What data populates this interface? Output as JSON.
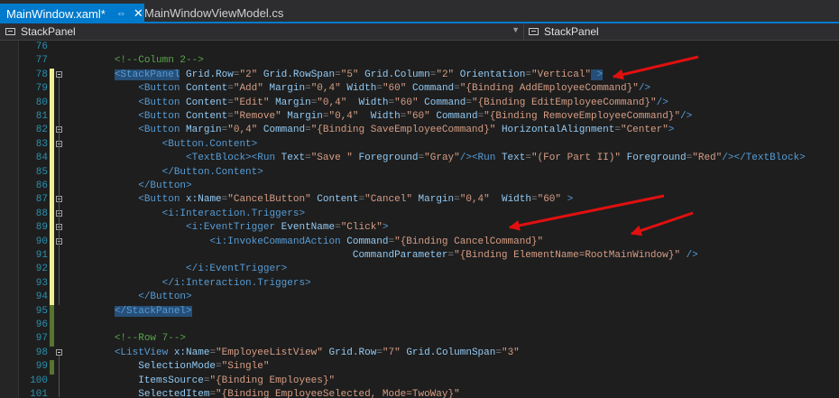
{
  "tabs": [
    {
      "label": "MainWindow.xaml*",
      "active": true
    },
    {
      "label": "MainWindowViewModel.cs",
      "active": false
    }
  ],
  "nav": {
    "left_combo": "StackPanel",
    "right_combo": "StackPanel"
  },
  "editor": {
    "lines": [
      {
        "n": "76",
        "chg": "",
        "fold": false,
        "t": [
          [
            "",
            ""
          ]
        ]
      },
      {
        "n": "77",
        "chg": "",
        "fold": false,
        "t": [
          [
            "        ",
            ""
          ],
          [
            "<!--Column 2-->",
            "c-cmt"
          ]
        ]
      },
      {
        "n": "78",
        "chg": "y",
        "fold": true,
        "t": [
          [
            "        ",
            ""
          ],
          [
            "<StackPanel",
            "c-tag sel"
          ],
          [
            " Grid.Row",
            "c-attr"
          ],
          [
            "=",
            "c-gray"
          ],
          [
            "\"2\"",
            "c-str"
          ],
          [
            " Grid.RowSpan",
            "c-attr"
          ],
          [
            "=",
            "c-gray"
          ],
          [
            "\"5\"",
            "c-str"
          ],
          [
            " Grid.Column",
            "c-attr"
          ],
          [
            "=",
            "c-gray"
          ],
          [
            "\"2\"",
            "c-str"
          ],
          [
            " Orientation",
            "c-attr"
          ],
          [
            "=",
            "c-gray"
          ],
          [
            "\"Vertical\"",
            "c-str"
          ],
          [
            " >",
            "c-tag sel"
          ]
        ]
      },
      {
        "n": "79",
        "chg": "y",
        "fold": false,
        "t": [
          [
            "            ",
            ""
          ],
          [
            "<Button",
            "c-tag"
          ],
          [
            " Content",
            "c-attr"
          ],
          [
            "=",
            "c-gray"
          ],
          [
            "\"Add\"",
            "c-str"
          ],
          [
            " Margin",
            "c-attr"
          ],
          [
            "=",
            "c-gray"
          ],
          [
            "\"0,4\"",
            "c-str"
          ],
          [
            " Width",
            "c-attr"
          ],
          [
            "=",
            "c-gray"
          ],
          [
            "\"60\"",
            "c-str"
          ],
          [
            " Command",
            "c-attr"
          ],
          [
            "=",
            "c-gray"
          ],
          [
            "\"{Binding AddEmployeeCommand}\"",
            "c-str"
          ],
          [
            "/>",
            "c-tag"
          ]
        ]
      },
      {
        "n": "80",
        "chg": "y",
        "fold": false,
        "t": [
          [
            "            ",
            ""
          ],
          [
            "<Button",
            "c-tag"
          ],
          [
            " Content",
            "c-attr"
          ],
          [
            "=",
            "c-gray"
          ],
          [
            "\"Edit\"",
            "c-str"
          ],
          [
            " Margin",
            "c-attr"
          ],
          [
            "=",
            "c-gray"
          ],
          [
            "\"0,4\"",
            "c-str"
          ],
          [
            "  Width",
            "c-attr"
          ],
          [
            "=",
            "c-gray"
          ],
          [
            "\"60\"",
            "c-str"
          ],
          [
            " Command",
            "c-attr"
          ],
          [
            "=",
            "c-gray"
          ],
          [
            "\"{Binding EditEmployeeCommand}\"",
            "c-str"
          ],
          [
            "/>",
            "c-tag"
          ]
        ]
      },
      {
        "n": "81",
        "chg": "y",
        "fold": false,
        "t": [
          [
            "            ",
            ""
          ],
          [
            "<Button",
            "c-tag"
          ],
          [
            " Content",
            "c-attr"
          ],
          [
            "=",
            "c-gray"
          ],
          [
            "\"Remove\"",
            "c-str"
          ],
          [
            " Margin",
            "c-attr"
          ],
          [
            "=",
            "c-gray"
          ],
          [
            "\"0,4\"",
            "c-str"
          ],
          [
            "  Width",
            "c-attr"
          ],
          [
            "=",
            "c-gray"
          ],
          [
            "\"60\"",
            "c-str"
          ],
          [
            " Command",
            "c-attr"
          ],
          [
            "=",
            "c-gray"
          ],
          [
            "\"{Binding RemoveEmployeeCommand}\"",
            "c-str"
          ],
          [
            "/>",
            "c-tag"
          ]
        ]
      },
      {
        "n": "82",
        "chg": "y",
        "fold": true,
        "t": [
          [
            "            ",
            ""
          ],
          [
            "<Button",
            "c-tag"
          ],
          [
            " Margin",
            "c-attr"
          ],
          [
            "=",
            "c-gray"
          ],
          [
            "\"0,4\"",
            "c-str"
          ],
          [
            " Command",
            "c-attr"
          ],
          [
            "=",
            "c-gray"
          ],
          [
            "\"{Binding SaveEmployeeCommand}\"",
            "c-str"
          ],
          [
            " HorizontalAlignment",
            "c-attr"
          ],
          [
            "=",
            "c-gray"
          ],
          [
            "\"Center\"",
            "c-str"
          ],
          [
            ">",
            "c-tag"
          ]
        ]
      },
      {
        "n": "83",
        "chg": "y",
        "fold": true,
        "t": [
          [
            "                ",
            ""
          ],
          [
            "<Button.Content>",
            "c-tag"
          ]
        ]
      },
      {
        "n": "84",
        "chg": "y",
        "fold": false,
        "t": [
          [
            "                    ",
            ""
          ],
          [
            "<TextBlock>",
            "c-tag"
          ],
          [
            "<Run",
            "c-tag"
          ],
          [
            " Text",
            "c-attr"
          ],
          [
            "=",
            "c-gray"
          ],
          [
            "\"Save \"",
            "c-str"
          ],
          [
            " Foreground",
            "c-attr"
          ],
          [
            "=",
            "c-gray"
          ],
          [
            "\"Gray\"",
            "c-str"
          ],
          [
            "/>",
            "c-tag"
          ],
          [
            "<Run",
            "c-tag"
          ],
          [
            " Text",
            "c-attr"
          ],
          [
            "=",
            "c-gray"
          ],
          [
            "\"(For Part II)\"",
            "c-str"
          ],
          [
            " Foreground",
            "c-attr"
          ],
          [
            "=",
            "c-gray"
          ],
          [
            "\"Red\"",
            "c-str"
          ],
          [
            "/>",
            "c-tag"
          ],
          [
            "</TextBlock>",
            "c-tag"
          ]
        ]
      },
      {
        "n": "85",
        "chg": "y",
        "fold": false,
        "t": [
          [
            "                ",
            ""
          ],
          [
            "</Button.Content>",
            "c-tag"
          ]
        ]
      },
      {
        "n": "86",
        "chg": "y",
        "fold": false,
        "t": [
          [
            "            ",
            ""
          ],
          [
            "</Button>",
            "c-tag"
          ]
        ]
      },
      {
        "n": "87",
        "chg": "y",
        "fold": true,
        "t": [
          [
            "            ",
            ""
          ],
          [
            "<Button",
            "c-tag"
          ],
          [
            " x:Name",
            "c-attr"
          ],
          [
            "=",
            "c-gray"
          ],
          [
            "\"CancelButton\"",
            "c-str"
          ],
          [
            " Content",
            "c-attr"
          ],
          [
            "=",
            "c-gray"
          ],
          [
            "\"Cancel\"",
            "c-str"
          ],
          [
            " Margin",
            "c-attr"
          ],
          [
            "=",
            "c-gray"
          ],
          [
            "\"0,4\"",
            "c-str"
          ],
          [
            "  Width",
            "c-attr"
          ],
          [
            "=",
            "c-gray"
          ],
          [
            "\"60\"",
            "c-str"
          ],
          [
            " >",
            "c-tag"
          ]
        ]
      },
      {
        "n": "88",
        "chg": "y",
        "fold": true,
        "t": [
          [
            "                ",
            ""
          ],
          [
            "<i:Interaction.Triggers>",
            "c-tag"
          ]
        ]
      },
      {
        "n": "89",
        "chg": "y",
        "fold": true,
        "t": [
          [
            "                    ",
            ""
          ],
          [
            "<i:EventTrigger",
            "c-tag"
          ],
          [
            " EventName",
            "c-attr"
          ],
          [
            "=",
            "c-gray"
          ],
          [
            "\"Click\"",
            "c-str"
          ],
          [
            ">",
            "c-tag"
          ]
        ]
      },
      {
        "n": "90",
        "chg": "y",
        "fold": true,
        "t": [
          [
            "                        ",
            ""
          ],
          [
            "<i:InvokeCommandAction",
            "c-tag"
          ],
          [
            " Command",
            "c-attr"
          ],
          [
            "=",
            "c-gray"
          ],
          [
            "\"{Binding CancelCommand}\"",
            "c-str"
          ]
        ]
      },
      {
        "n": "91",
        "chg": "y",
        "fold": false,
        "t": [
          [
            "                                                ",
            ""
          ],
          [
            "CommandParameter",
            "c-attr"
          ],
          [
            "=",
            "c-gray"
          ],
          [
            "\"{Binding ElementName=RootMainWindow}\"",
            "c-str"
          ],
          [
            " />",
            "c-tag"
          ]
        ]
      },
      {
        "n": "92",
        "chg": "y",
        "fold": false,
        "t": [
          [
            "                    ",
            ""
          ],
          [
            "</i:EventTrigger>",
            "c-tag"
          ]
        ]
      },
      {
        "n": "93",
        "chg": "y",
        "fold": false,
        "t": [
          [
            "                ",
            ""
          ],
          [
            "</i:Interaction.Triggers>",
            "c-tag"
          ]
        ]
      },
      {
        "n": "94",
        "chg": "y",
        "fold": false,
        "t": [
          [
            "            ",
            ""
          ],
          [
            "</Button>",
            "c-tag"
          ]
        ]
      },
      {
        "n": "95",
        "chg": "g",
        "fold": false,
        "t": [
          [
            "        ",
            ""
          ],
          [
            "</StackPanel>",
            "c-tag sel"
          ]
        ]
      },
      {
        "n": "96",
        "chg": "g",
        "fold": false,
        "t": [
          [
            "",
            ""
          ]
        ]
      },
      {
        "n": "97",
        "chg": "g",
        "fold": false,
        "t": [
          [
            "        ",
            ""
          ],
          [
            "<!--Row 7-->",
            "c-cmt"
          ]
        ]
      },
      {
        "n": "98",
        "chg": "",
        "fold": true,
        "t": [
          [
            "        ",
            ""
          ],
          [
            "<ListView",
            "c-tag"
          ],
          [
            " x:Name",
            "c-attr"
          ],
          [
            "=",
            "c-gray"
          ],
          [
            "\"EmployeeListView\"",
            "c-str"
          ],
          [
            " Grid.Row",
            "c-attr"
          ],
          [
            "=",
            "c-gray"
          ],
          [
            "\"7\"",
            "c-str"
          ],
          [
            " Grid.ColumnSpan",
            "c-attr"
          ],
          [
            "=",
            "c-gray"
          ],
          [
            "\"3\"",
            "c-str"
          ]
        ]
      },
      {
        "n": "99",
        "chg": "g",
        "fold": false,
        "t": [
          [
            "            ",
            ""
          ],
          [
            "SelectionMode",
            "c-attr"
          ],
          [
            "=",
            "c-gray"
          ],
          [
            "\"Single\"",
            "c-str"
          ]
        ]
      },
      {
        "n": "100",
        "chg": "",
        "fold": false,
        "t": [
          [
            "            ",
            ""
          ],
          [
            "ItemsSource",
            "c-attr"
          ],
          [
            "=",
            "c-gray"
          ],
          [
            "\"{Binding Employees}\"",
            "c-str"
          ]
        ]
      },
      {
        "n": "101",
        "chg": "",
        "fold": false,
        "t": [
          [
            "            ",
            ""
          ],
          [
            "SelectedItem",
            "c-attr"
          ],
          [
            "=",
            "c-gray"
          ],
          [
            "\"{Binding EmployeeSelected, Mode=TwoWay}\"",
            "c-str"
          ]
        ]
      }
    ]
  },
  "colors": {
    "tab_active_bg": "#007acc",
    "editor_bg": "#1e1e1e",
    "tag": "#569cd6",
    "attribute": "#92caf4",
    "string": "#d69d85",
    "comment": "#57a64a",
    "line_number": "#2b91af",
    "annotation_arrow": "#e01010"
  },
  "annotations": {
    "arrows": 3,
    "arrow_color": "red"
  }
}
